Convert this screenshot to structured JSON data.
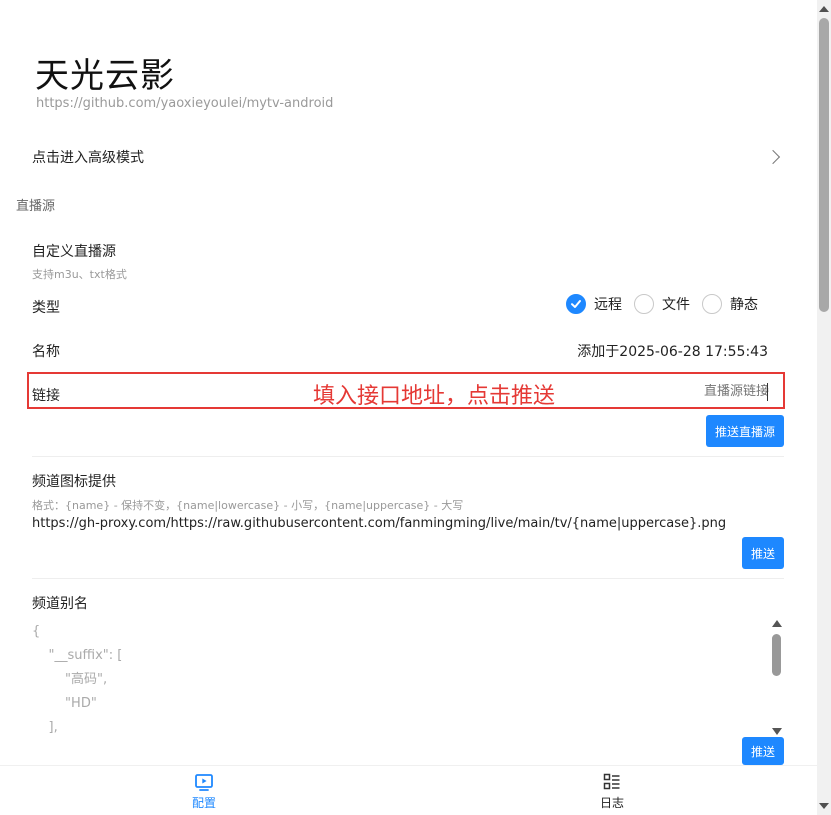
{
  "header": {
    "title": "天光云影",
    "subtitle": "https://github.com/yaoxieyoulei/mytv-android"
  },
  "advanced": {
    "label": "点击进入高级模式"
  },
  "section": {
    "title": "直播源"
  },
  "custom_source": {
    "title": "自定义直播源",
    "hint": "支持m3u、txt格式",
    "type_label": "类型",
    "type_options": [
      {
        "label": "远程",
        "selected": true
      },
      {
        "label": "文件",
        "selected": false
      },
      {
        "label": "静态",
        "selected": false
      }
    ],
    "name_label": "名称",
    "name_value": "添加于2025-06-28 17:55:43",
    "link_label": "链接",
    "link_placeholder": "直播源链接",
    "annotation": "填入接口地址，点击推送",
    "push_button": "推送直播源"
  },
  "channel_logo": {
    "title": "频道图标提供",
    "hint": "格式：{name} - 保持不变，{name|lowercase} - 小写，{name|uppercase} - 大写",
    "value": "https://gh-proxy.com/https://raw.githubusercontent.com/fanmingming/live/main/tv/{name|uppercase}.png",
    "push_button": "推送"
  },
  "channel_alias": {
    "title": "频道别名",
    "code_lines": [
      "{",
      "    \"__suffix\": [",
      "        \"高码\",",
      "        \"HD\"",
      "    ],"
    ],
    "push_button": "推送"
  },
  "bottom_nav": {
    "tabs": [
      {
        "label": "配置",
        "active": true
      },
      {
        "label": "日志",
        "active": false
      }
    ]
  },
  "colors": {
    "accent": "#1e88ff",
    "annotation": "#e53935"
  }
}
